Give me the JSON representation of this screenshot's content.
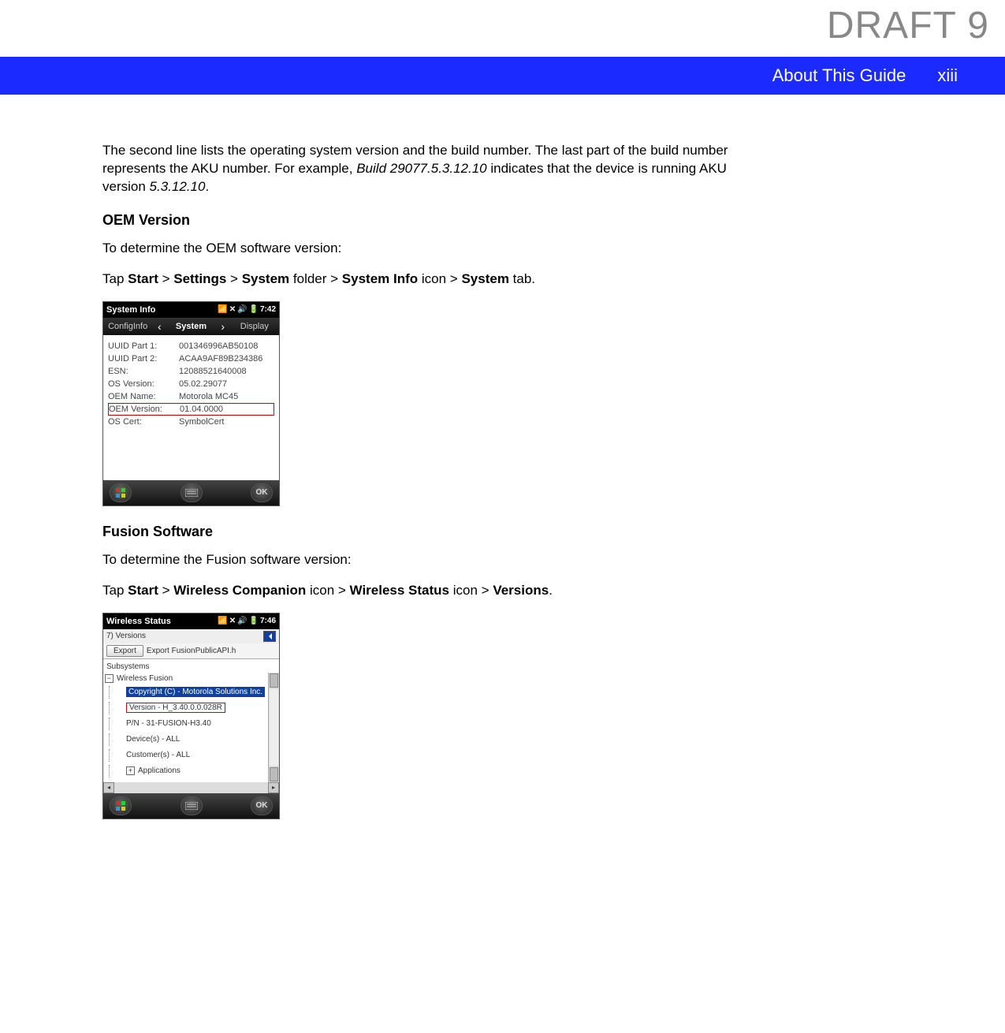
{
  "watermark": "DRAFT 9",
  "header": {
    "section": "About This Guide",
    "page": "xiii"
  },
  "intro": {
    "line1a": "The second line lists the operating system version and the build number. The last part of the build number represents the AKU number. For example, ",
    "build_example": "Build 29077.5.3.12.10",
    "line1b": " indicates that the device is running AKU version ",
    "aku_example": "5.3.12.10",
    "line1c": "."
  },
  "oem": {
    "heading": "OEM Version",
    "desc": "To determine the OEM software version:",
    "path_prefix": "Tap ",
    "p1": "Start",
    "s1": " > ",
    "p2": "Settings",
    "s2": " > ",
    "p3": "System",
    "p3_suffix": " folder > ",
    "p4": "System Info",
    "p4_suffix": " icon > ",
    "p5": "System",
    "p5_suffix": " tab.",
    "shot": {
      "title": "System Info",
      "time": "7:42",
      "tabs": {
        "left": "ConfigInfo",
        "mid": "System",
        "right": "Display"
      },
      "rows": [
        {
          "k": "UUID Part 1:",
          "v": "001346996AB50108"
        },
        {
          "k": "UUID Part 2:",
          "v": "ACAA9AF89B234386"
        },
        {
          "k": "ESN:",
          "v": "12088521640008"
        },
        {
          "k": "OS Version:",
          "v": "05.02.29077"
        },
        {
          "k": "OEM Name:",
          "v": "Motorola MC45"
        },
        {
          "k": "OEM Version:",
          "v": "01.04.0000"
        },
        {
          "k": "OS Cert:",
          "v": "SymbolCert"
        }
      ],
      "highlight_index": 5,
      "ok": "OK"
    }
  },
  "fusion": {
    "heading": "Fusion Software",
    "desc": "To determine the Fusion software version:",
    "path_prefix": "Tap ",
    "p1": "Start",
    "s1": " > ",
    "p2": "Wireless Companion",
    "p2_suffix": " icon > ",
    "p3": "Wireless Status",
    "p3_suffix": " icon > ",
    "p4": "Versions",
    "p4_suffix": ".",
    "shot": {
      "title": "Wireless Status",
      "time": "7:46",
      "subtitle": "7) Versions",
      "export_btn": "Export",
      "export_label": "Export FusionPublicAPI.h",
      "section": "Subsystems",
      "tree": {
        "root": "Wireless Fusion",
        "copyright": "Copyright (C) - Motorola Solutions Inc.",
        "version": "Version - H_3.40.0.0.028R",
        "pn": "P/N - 31-FUSION-H3.40",
        "devices": "Device(s) - ALL",
        "customers": "Customer(s) - ALL",
        "apps": "Applications"
      },
      "ok": "OK"
    }
  }
}
